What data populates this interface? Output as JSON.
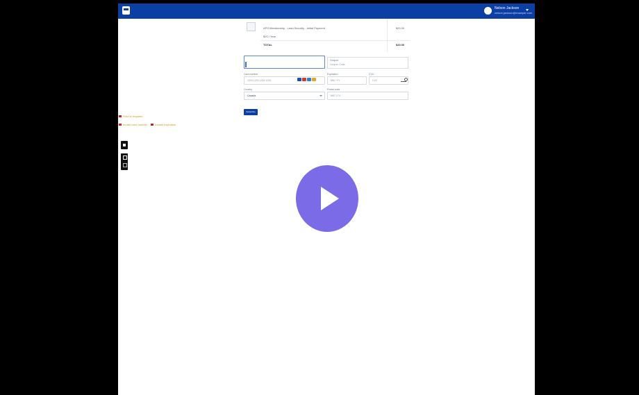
{
  "header": {
    "user_name": "Nelson Jackson",
    "user_email": "nelson.jackson@example.com"
  },
  "order": {
    "line1_label": "APS Membership - Lead Security - Initial Payment",
    "line1_price": "$20.00",
    "line2_label": "$20 / Year",
    "total_label": "TOTAL",
    "total_price": "$20.00"
  },
  "payment_form": {
    "name_label": "",
    "name_value": "",
    "coupon_label": "Coupon",
    "coupon_value": "Coupon Code",
    "card_label": "Card number",
    "card_placeholder": "1234 1234 1234 1234",
    "expiry_label": "Expiration",
    "expiry_placeholder": "MM / YY",
    "cvc_label": "CVC",
    "cvc_placeholder": "CVC",
    "country_label": "Country",
    "country_value": "Canada",
    "postal_label": "Postal code",
    "postal_placeholder": "M5T 1T4",
    "submit_label": "Subscribe"
  },
  "errors": {
    "e1": "Field is required",
    "e2": "Invalid card number",
    "e3": "Invalid expiration"
  },
  "colors": {
    "header_bg": "#0b3fa3",
    "play_button": "#7b6be6",
    "error_text": "#d39a1b"
  },
  "icons": {
    "logo": "app-logo-icon",
    "play": "play-icon"
  }
}
